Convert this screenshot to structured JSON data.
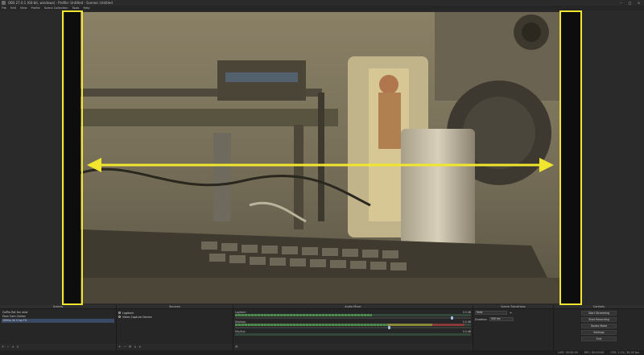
{
  "window": {
    "title": "OBS 27.0.1 (64-bit, windows) - Profile: Untitled - Scenes: Untitled"
  },
  "menu": {
    "items": [
      "File",
      "Edit",
      "View",
      "Profile",
      "Scene Collection",
      "Tools",
      "Help"
    ]
  },
  "annotation": {
    "color": "#f2e52e"
  },
  "docks": {
    "scenes": {
      "title": "Scenes",
      "items": [
        "GoPro flat fov shot",
        "Face Cam Center",
        "1080p 4k Crop Fit"
      ]
    },
    "sources": {
      "title": "Sources",
      "items": [
        "Logitech",
        "Video Capture Device"
      ]
    },
    "mixer": {
      "title": "Audio Mixer",
      "tracks": [
        {
          "name": "Logitech",
          "db": "0.0 dB",
          "level": 0.58
        },
        {
          "name": "Desktop",
          "db": "0.0 dB",
          "level": 0.9
        },
        {
          "name": "Mic/Aux",
          "db": "0.0 dB",
          "level": 0.0
        }
      ]
    },
    "transitions": {
      "title": "Scene Transitions",
      "selected": "Fade",
      "duration_label": "Duration",
      "duration_value": "300 ms"
    },
    "controls": {
      "title": "Controls",
      "buttons": [
        "Start Streaming",
        "Start Recording",
        "Studio Mode",
        "Settings",
        "Exit"
      ]
    }
  },
  "status": {
    "live": "LIVE: 00:00:00",
    "rec": "REC: 00:00:00",
    "cpu": "CPU: 2.1%, 30.00 fps"
  }
}
